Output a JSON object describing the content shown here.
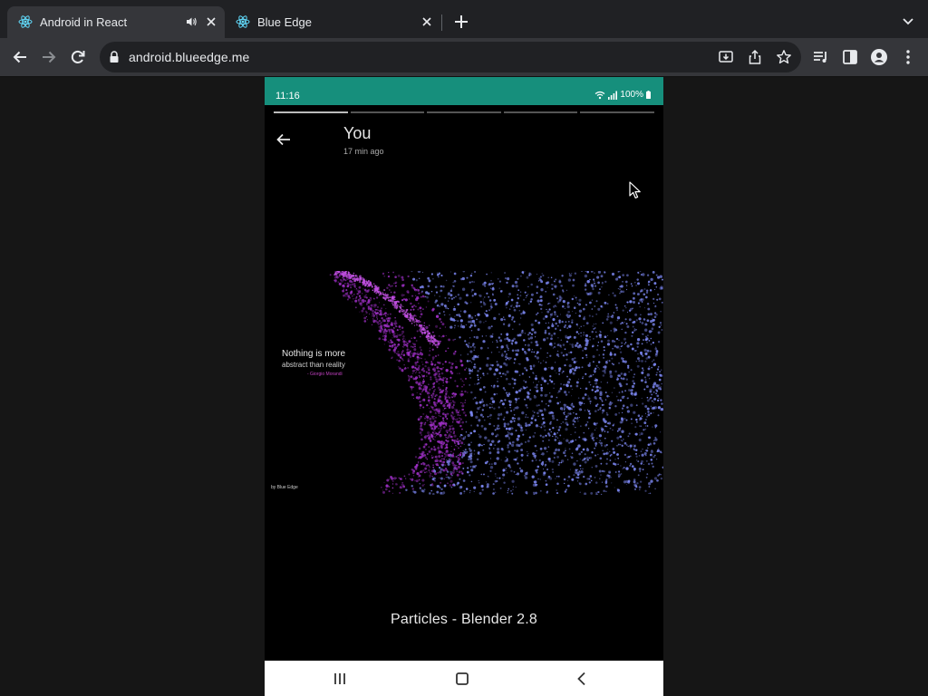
{
  "browser": {
    "tabs": [
      {
        "title": "Android in React",
        "active": true,
        "audio": true
      },
      {
        "title": "Blue Edge",
        "active": false,
        "audio": false
      }
    ],
    "url": "android.blueedge.me"
  },
  "phone": {
    "status_time": "11:16",
    "battery": "100%",
    "story": {
      "user": "You",
      "time_ago": "17 min ago",
      "segments": 5,
      "quote_line1": "Nothing is more",
      "quote_line2": "abstract than reality",
      "quote_author": "- Giorgio Morandi",
      "credit": "by Blue Edge",
      "caption": "Particles - Blender 2.8"
    }
  },
  "colors": {
    "status_bar": "#168f7c",
    "tab_bg": "#202124",
    "toolbar_bg": "#35363a",
    "particle_purple": "#a030c8",
    "particle_blue": "#7b86f0"
  },
  "icons": [
    "react-icon",
    "speaker-icon",
    "close-icon",
    "plus-icon",
    "chevron-down-icon",
    "back-arrow-icon",
    "forward-arrow-icon",
    "reload-icon",
    "lock-icon",
    "install-icon",
    "share-icon",
    "star-icon",
    "media-icon",
    "side-panel-icon",
    "profile-icon",
    "more-icon",
    "wifi-icon",
    "signal-icon",
    "battery-icon",
    "recents-icon",
    "home-icon",
    "nav-back-icon",
    "cursor-icon"
  ]
}
